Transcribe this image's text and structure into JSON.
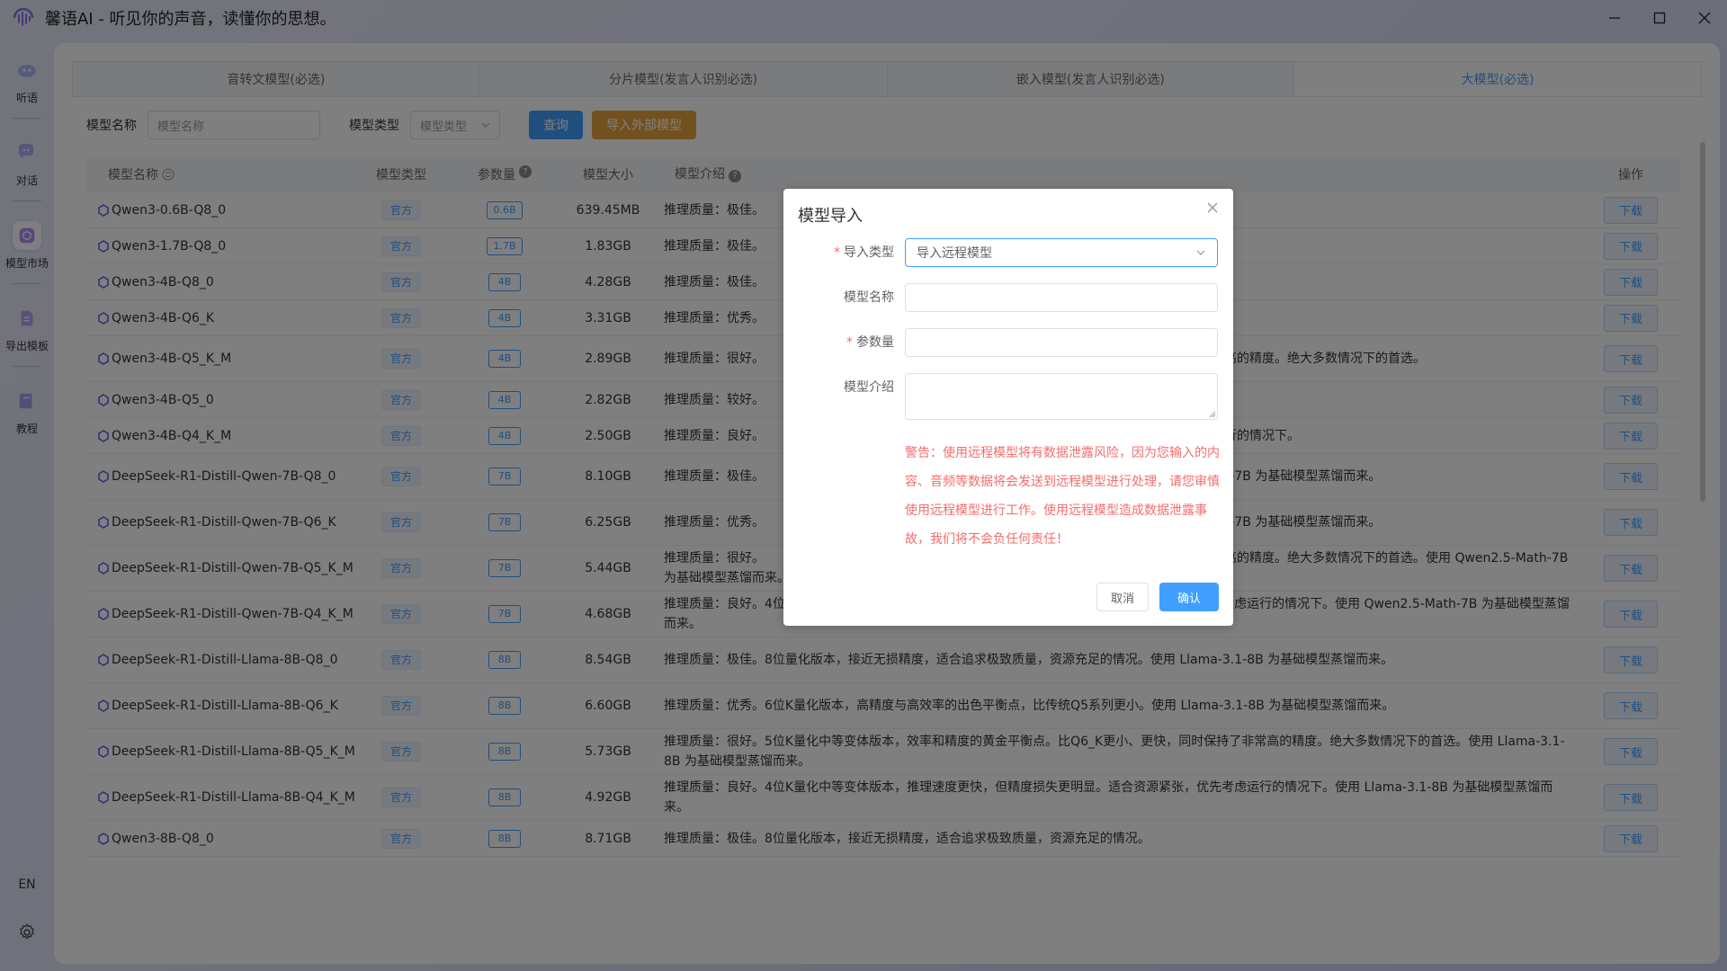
{
  "app": {
    "title": "馨语AI - 听见你的声音，读懂你的思想。",
    "window_controls": {
      "minimize": "—",
      "maximize": "☐",
      "close": "✕"
    }
  },
  "sidebar": {
    "items": [
      {
        "label": "听语",
        "icon": "ear-icon"
      },
      {
        "label": "对话",
        "icon": "chat-icon"
      },
      {
        "label": "模型市场",
        "icon": "cube-icon",
        "active": true
      },
      {
        "label": "导出模板",
        "icon": "document-icon"
      },
      {
        "label": "教程",
        "icon": "book-icon"
      }
    ],
    "language": "EN"
  },
  "tabs": [
    {
      "label": "音转文模型(必选)"
    },
    {
      "label": "分片模型(发言人识别必选)"
    },
    {
      "label": "嵌入模型(发言人识别必选)"
    },
    {
      "label": "大模型(必选)",
      "active": true
    }
  ],
  "filter": {
    "name_label": "模型名称",
    "name_placeholder": "模型名称",
    "type_label": "模型类型",
    "type_placeholder": "模型类型",
    "query_button": "查询",
    "import_button": "导入外部模型"
  },
  "table": {
    "headers": {
      "name": "模型名称",
      "type": "模型类型",
      "params": "参数量",
      "size": "模型大小",
      "desc": "模型介绍",
      "op": "操作"
    },
    "rows": [
      {
        "name": "Qwen3-0.6B-Q8_0",
        "type": "官方",
        "params": "0.6B",
        "size": "639.45MB",
        "desc": "推理质量：极佳。"
      },
      {
        "name": "Qwen3-1.7B-Q8_0",
        "type": "官方",
        "params": "1.7B",
        "size": "1.83GB",
        "desc": "推理质量：极佳。"
      },
      {
        "name": "Qwen3-4B-Q8_0",
        "type": "官方",
        "params": "4B",
        "size": "4.28GB",
        "desc": "推理质量：极佳。"
      },
      {
        "name": "Qwen3-4B-Q6_K",
        "type": "官方",
        "params": "4B",
        "size": "3.31GB",
        "desc": "推理质量：优秀。"
      },
      {
        "name": "Qwen3-4B-Q5_K_M",
        "type": "官方",
        "params": "4B",
        "size": "2.89GB",
        "desc": "推理质量：很好。　　　　　　　　　　　　　　　　　　　　　　　　　　　　　　　　　持了非常高的精度。绝大多数情况下的首选。"
      },
      {
        "name": "Qwen3-4B-Q5_0",
        "type": "官方",
        "params": "4B",
        "size": "2.82GB",
        "desc": "推理质量：较好。"
      },
      {
        "name": "Qwen3-4B-Q4_K_M",
        "type": "官方",
        "params": "4B",
        "size": "2.50GB",
        "desc": "推理质量：良好。　　　　　　　　　　　　　　　　　　　　　　　　　　　　　　　　　先考虑运行的情况下。"
      },
      {
        "name": "DeepSeek-R1-Distill-Qwen-7B-Q8_0",
        "type": "官方",
        "params": "7B",
        "size": "8.10GB",
        "desc": "推理质量：极佳。　　　　　　　　　　　　　　　　　　　　　　　　　　　　　　　　　2.5-Math-7B 为基础模型蒸馏而来。"
      },
      {
        "name": "DeepSeek-R1-Distill-Qwen-7B-Q6_K",
        "type": "官方",
        "params": "7B",
        "size": "6.25GB",
        "desc": "推理质量：优秀。　　　　　　　　　　　　　　　　　　　　　　　　　　　　　　　　　2.5-Math-7B 为基础模型蒸馏而来。"
      },
      {
        "name": "DeepSeek-R1-Distill-Qwen-7B-Q5_K_M",
        "type": "官方",
        "params": "7B",
        "size": "5.44GB",
        "desc": "推理质量：很好。　　　　　　　　　　　　　　　　　　　　　　　　　　　　　　　　　持了非常高的精度。绝大多数情况下的首选。使用 Qwen2.5-Math-7B 为基础模型蒸馏而来。"
      },
      {
        "name": "DeepSeek-R1-Distill-Qwen-7B-Q4_K_M",
        "type": "官方",
        "params": "7B",
        "size": "4.68GB",
        "desc": "推理质量：良好。4位K量化中等变体版本，推理速度更快，但精度损失更明显。适合资源紧张，优先考虑运行的情况下。使用 Qwen2.5-Math-7B 为基础模型蒸馏而来。"
      },
      {
        "name": "DeepSeek-R1-Distill-Llama-8B-Q8_0",
        "type": "官方",
        "params": "8B",
        "size": "8.54GB",
        "desc": "推理质量：极佳。8位量化版本，接近无损精度，适合追求极致质量，资源充足的情况。使用 Llama-3.1-8B 为基础模型蒸馏而来。"
      },
      {
        "name": "DeepSeek-R1-Distill-Llama-8B-Q6_K",
        "type": "官方",
        "params": "8B",
        "size": "6.60GB",
        "desc": "推理质量：优秀。6位K量化版本，高精度与高效率的出色平衡点，比传统Q5系列更小。使用 Llama-3.1-8B 为基础模型蒸馏而来。"
      },
      {
        "name": "DeepSeek-R1-Distill-Llama-8B-Q5_K_M",
        "type": "官方",
        "params": "8B",
        "size": "5.73GB",
        "desc": "推理质量：很好。5位K量化中等变体版本，效率和精度的黄金平衡点。比Q6_K更小、更快，同时保持了非常高的精度。绝大多数情况下的首选。使用 Llama-3.1-8B 为基础模型蒸馏而来。"
      },
      {
        "name": "DeepSeek-R1-Distill-Llama-8B-Q4_K_M",
        "type": "官方",
        "params": "8B",
        "size": "4.92GB",
        "desc": "推理质量：良好。4位K量化中等变体版本，推理速度更快，但精度损失更明显。适合资源紧张，优先考虑运行的情况下。使用 Llama-3.1-8B 为基础模型蒸馏而来。"
      },
      {
        "name": "Qwen3-8B-Q8_0",
        "type": "官方",
        "params": "8B",
        "size": "8.71GB",
        "desc": "推理质量：极佳。8位量化版本，接近无损精度，适合追求极致质量，资源充足的情况。"
      }
    ],
    "download_label": "下载"
  },
  "dialog": {
    "title": "模型导入",
    "import_type_label": "导入类型",
    "import_type_value": "导入远程模型",
    "model_name_label": "模型名称",
    "model_name_value": "",
    "params_label": "参数量",
    "params_value": "",
    "intro_label": "模型介绍",
    "warning": "警告：使用远程模型将有数据泄露风险，因为您输入的内容、音频等数据将会发送到远程模型进行处理，请您审慎使用远程模型进行工作。使用远程模型造成数据泄露事故，我们将不会负任何责任！",
    "cancel": "取消",
    "confirm": "确认"
  },
  "colors": {
    "primary": "#409eff",
    "warning": "#e6a23c",
    "danger": "#f56c6c"
  }
}
